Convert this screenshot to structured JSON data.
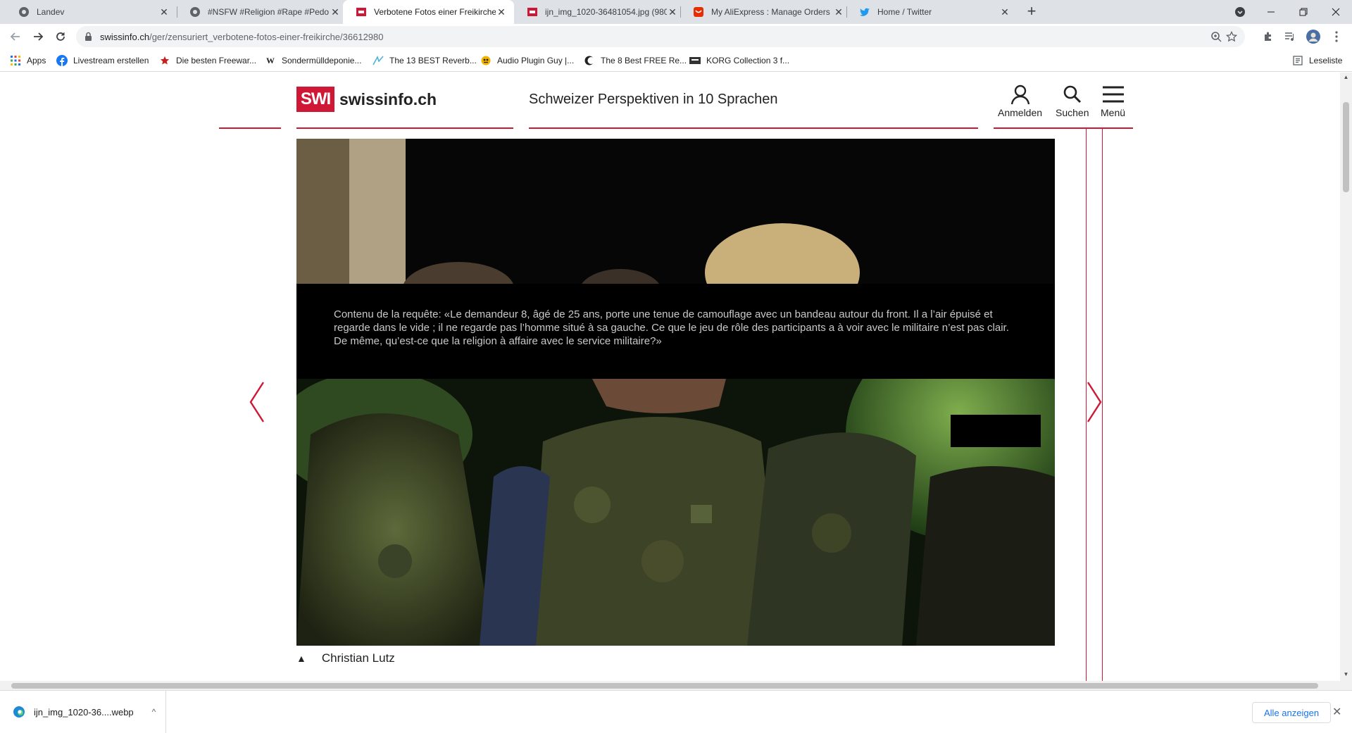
{
  "tabs": [
    {
      "title": "Landev",
      "icon": "gear-icon"
    },
    {
      "title": "#NSFW #Religion #Rape #Pedo #",
      "icon": "gear-icon"
    },
    {
      "title": "Verbotene Fotos einer Freikirche",
      "icon": "swi-icon",
      "active": true
    },
    {
      "title": "ijn_img_1020-36481054.jpg (980",
      "icon": "swi-icon"
    },
    {
      "title": "My AliExpress : Manage Orders",
      "icon": "aliexpress-icon"
    },
    {
      "title": "Home / Twitter",
      "icon": "twitter-icon"
    }
  ],
  "toolbar": {
    "url_host": "swissinfo.ch",
    "url_path": "/ger/zensuriert_verbotene-fotos-einer-freikirche/36612980"
  },
  "bookmarks": [
    {
      "label": "Apps",
      "icon": "apps-grid-icon"
    },
    {
      "label": "Livestream erstellen",
      "icon": "facebook-icon"
    },
    {
      "label": "Die besten Freewar...",
      "icon": "star-icon"
    },
    {
      "label": "Sondermülldeponie...",
      "icon": "wikipedia-icon"
    },
    {
      "label": "The 13 BEST Reverb...",
      "icon": "plugin-icon"
    },
    {
      "label": "Audio Plugin Guy |...",
      "icon": "audio-plugin-icon"
    },
    {
      "label": "The 8 Best FREE Re...",
      "icon": "moon-icon"
    },
    {
      "label": "KORG Collection 3 f...",
      "icon": "korg-icon"
    }
  ],
  "reading_list": "Leseliste",
  "site": {
    "logo_box": "SWI",
    "logo_text": "swissinfo.ch",
    "tagline": "Schweizer Perspektiven in 10 Sprachen",
    "login": "Anmelden",
    "search": "Suchen",
    "menu": "Menü"
  },
  "gallery": {
    "censor_text": "Contenu de la requête: «Le demandeur 8, âgé de 25 ans, porte une tenue de camouflage avec un bandeau autour du front. Il a l’air épuisé et regarde dans le vide ; il ne regarde pas l’homme situé à sa gauche. Ce que le jeu de rôle des participants a à voir avec le militaire n’est pas clair. De même, qu’est-ce que la religion à affaire avec le service militaire?»",
    "caption": "Christian Lutz"
  },
  "downloads": {
    "file": "ijn_img_1020-36....webp",
    "show_all": "Alle anzeigen"
  },
  "colors": {
    "brand_red": "#cf1736",
    "tab_strip": "#dee1e6"
  }
}
